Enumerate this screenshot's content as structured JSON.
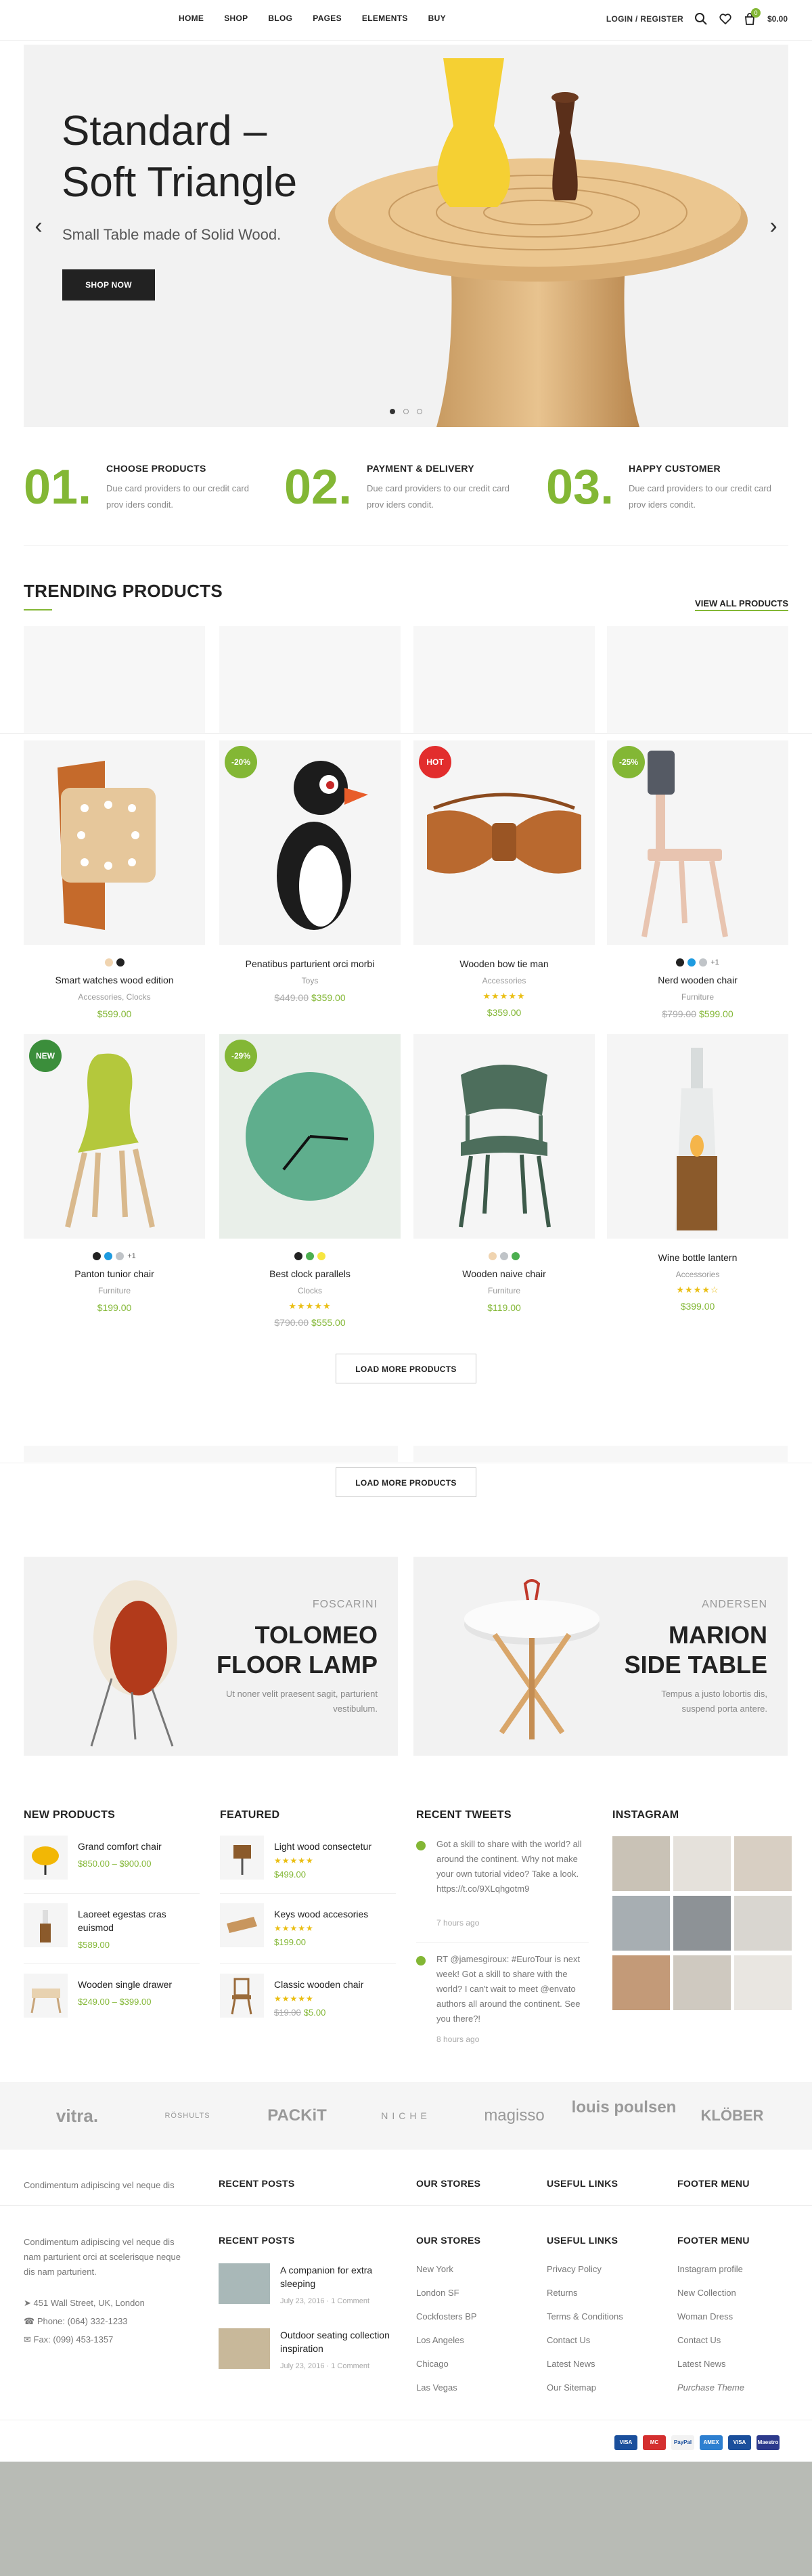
{
  "nav": {
    "items": [
      "HOME",
      "SHOP",
      "BLOG",
      "PAGES",
      "ELEMENTS",
      "BUY"
    ],
    "login": "LOGIN / REGISTER",
    "cart_count": "0",
    "cart_total": "$0.00"
  },
  "hero": {
    "title": "Standard – Soft Triangle",
    "subtitle": "Small Table made of Solid Wood.",
    "button": "SHOP NOW",
    "prev": "‹",
    "next": "›"
  },
  "features": [
    {
      "num": "01.",
      "title": "CHOOSE PRODUCTS",
      "text": "Due card providers to our credit card prov iders condit."
    },
    {
      "num": "02.",
      "title": "PAYMENT & DELIVERY",
      "text": "Due card providers to our credit card prov iders condit."
    },
    {
      "num": "03.",
      "title": "HAPPY CUSTOMER",
      "text": "Due card providers to our credit card prov iders condit."
    }
  ],
  "trending": {
    "title": "TRENDING PRODUCTS",
    "view_all": "VIEW ALL PRODUCTS",
    "products": [
      {
        "name": "Smart watches wood edition",
        "category": "Accessories, Clocks",
        "price": "$599.00",
        "old_price": "",
        "badge": "",
        "stars": "",
        "swatches": [
          "#f0d4b0",
          "#222222"
        ],
        "more": ""
      },
      {
        "name": "Penatibus parturient orci morbi",
        "category": "Toys",
        "price": "$359.00",
        "old_price": "$449.00",
        "badge": "-20%",
        "stars": "",
        "swatches": [],
        "more": ""
      },
      {
        "name": "Wooden bow tie man",
        "category": "Accessories",
        "price": "$359.00",
        "old_price": "",
        "badge": "HOT",
        "stars": "★★★★★",
        "swatches": [],
        "more": ""
      },
      {
        "name": "Nerd wooden chair",
        "category": "Furniture",
        "price": "$599.00",
        "old_price": "$799.00",
        "badge": "-25%",
        "stars": "",
        "swatches": [
          "#222222",
          "#1e9be0",
          "#c0c4c8"
        ],
        "more": "+1"
      },
      {
        "name": "Panton tunior chair",
        "category": "Furniture",
        "price": "$199.00",
        "old_price": "",
        "badge": "NEW",
        "stars": "",
        "swatches": [
          "#222222",
          "#1e9be0",
          "#c0c4c8"
        ],
        "more": "+1"
      },
      {
        "name": "Best clock parallels",
        "category": "Clocks",
        "price": "$555.00",
        "old_price": "$790.00",
        "badge": "-29%",
        "stars": "★★★★★",
        "swatches": [
          "#222222",
          "#4caf50",
          "#f7e640"
        ],
        "more": ""
      },
      {
        "name": "Wooden naive chair",
        "category": "Furniture",
        "price": "$119.00",
        "old_price": "",
        "badge": "",
        "stars": "",
        "swatches": [
          "#f0d4b0",
          "#c0c4c8",
          "#4caf50"
        ],
        "more": ""
      },
      {
        "name": "Wine bottle lantern",
        "category": "Accessories",
        "price": "$399.00",
        "old_price": "",
        "badge": "",
        "stars": "★★★★☆",
        "swatches": [],
        "more": ""
      }
    ],
    "load_more": "LOAD MORE PRODUCTS"
  },
  "banners": [
    {
      "brand": "FOSCARINI",
      "title": "TOLOMEO FLOOR LAMP",
      "text": "Ut noner velit praesent sagit, parturient vestibulum."
    },
    {
      "brand": "ANDERSEN",
      "title": "MARION SIDE TABLE",
      "text": "Tempus a justo lobortis dis, suspend porta antere."
    }
  ],
  "widgets": {
    "new_products": {
      "title": "NEW PRODUCTS",
      "items": [
        {
          "name": "Grand comfort chair",
          "price": "$850.00 – $900.00",
          "old": "",
          "stars": ""
        },
        {
          "name": "Laoreet egestas cras euismod",
          "price": "$589.00",
          "old": "",
          "stars": ""
        },
        {
          "name": "Wooden single drawer",
          "price": "$249.00 – $399.00",
          "old": "",
          "stars": ""
        }
      ]
    },
    "featured": {
      "title": "FEATURED",
      "items": [
        {
          "name": "Light wood consectetur",
          "price": "$499.00",
          "old": "",
          "stars": "★★★★★"
        },
        {
          "name": "Keys wood accesories",
          "price": "$199.00",
          "old": "",
          "stars": "★★★★★"
        },
        {
          "name": "Classic wooden chair",
          "price": "$5.00",
          "old": "$19.00",
          "stars": "★★★★★"
        }
      ]
    },
    "tweets": {
      "title": "RECENT TWEETS",
      "items": [
        {
          "text": "Got a skill to share with the world? all around the continent. Why not make your own tutorial video? Take a look. https://t.co/9XLqhgotm9",
          "time": "7 hours ago"
        },
        {
          "text": "RT @jamesgiroux: #EuroTour is next week! Got a skill to share with the world? I can't wait to meet @envato authors all around the continent. See you there?!",
          "time": "8 hours ago"
        }
      ]
    },
    "instagram": {
      "title": "INSTAGRAM"
    }
  },
  "brands": [
    "vitra.",
    "RÖSHULTS",
    "PACKiT",
    "NICHE",
    "magisso",
    "louis poulsen",
    "KLÖBER"
  ],
  "footer_peek": {
    "text": "Condimentum adipiscing vel neque dis",
    "cols": [
      "RECENT POSTS",
      "OUR STORES",
      "USEFUL LINKS",
      "FOOTER MENU"
    ]
  },
  "footer": {
    "about": "Condimentum adipiscing vel neque dis nam parturient orci at scelerisque neque dis nam parturient.",
    "address": "451 Wall Street, UK, London",
    "phone": "Phone: (064) 332-1233",
    "fax": "Fax: (099) 453-1357",
    "recent_posts": {
      "title": "RECENT POSTS",
      "items": [
        {
          "title": "A companion for extra sleeping",
          "date": "July 23, 2016",
          "comments": "1 Comment"
        },
        {
          "title": "Outdoor seating collection inspiration",
          "date": "July 23, 2016",
          "comments": "1 Comment"
        }
      ]
    },
    "stores": {
      "title": "OUR STORES",
      "links": [
        "New York",
        "London SF",
        "Cockfosters BP",
        "Los Angeles",
        "Chicago",
        "Las Vegas"
      ]
    },
    "useful": {
      "title": "USEFUL LINKS",
      "links": [
        "Privacy Policy",
        "Returns",
        "Terms & Conditions",
        "Contact Us",
        "Latest News",
        "Our Sitemap"
      ]
    },
    "menu": {
      "title": "FOOTER MENU",
      "links": [
        "Instagram profile",
        "New Collection",
        "Woman Dress",
        "Contact Us",
        "Latest News",
        "Purchase Theme"
      ]
    },
    "payments": [
      "VISA",
      "MC",
      "PayPal",
      "AMEX",
      "VISA",
      "Maestro"
    ]
  }
}
